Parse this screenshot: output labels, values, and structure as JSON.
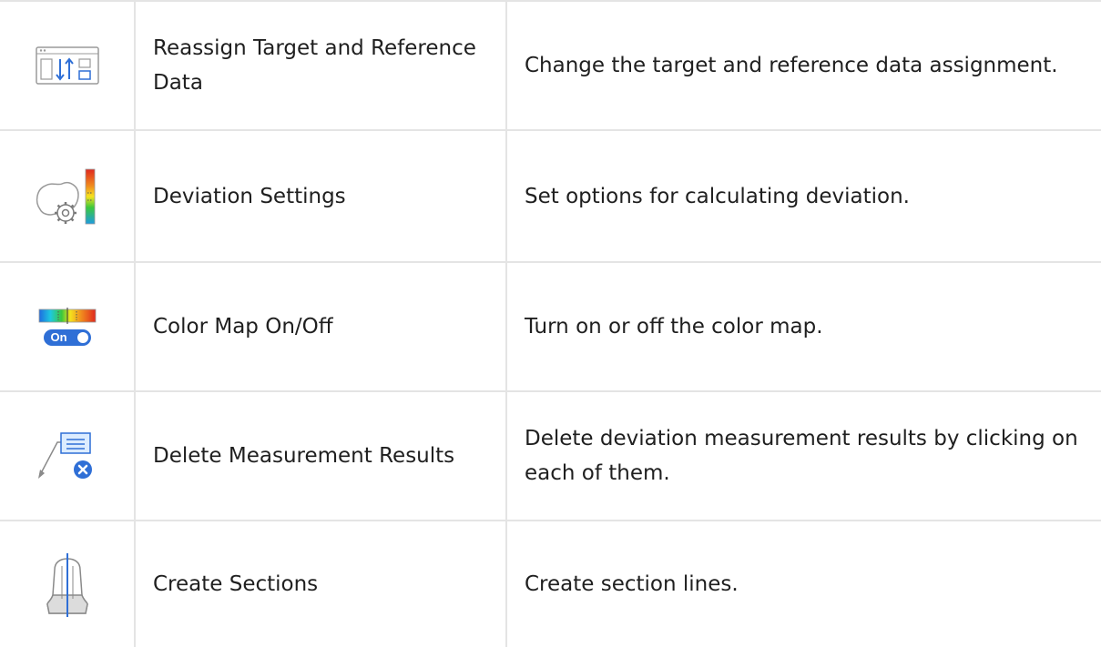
{
  "rows": [
    {
      "icon": "reassign-data-icon",
      "name": "Reassign Target and Reference Data",
      "description": "Change the target and reference data assignment."
    },
    {
      "icon": "deviation-settings-icon",
      "name": "Deviation Settings",
      "description": "Set options for calculating deviation."
    },
    {
      "icon": "color-map-toggle-icon",
      "name": "Color Map On/Off",
      "description": "Turn on or off the color map.",
      "toggle_label": "On"
    },
    {
      "icon": "delete-measurement-icon",
      "name": "Delete Measurement Results",
      "description": "Delete deviation measurement results by clicking on each of them."
    },
    {
      "icon": "create-sections-icon",
      "name": "Create Sections",
      "description": "Create section lines."
    }
  ],
  "colors": {
    "border": "#e4e4e4",
    "accent_blue": "#2f6fd6",
    "icon_gray": "#9a9a9a"
  }
}
